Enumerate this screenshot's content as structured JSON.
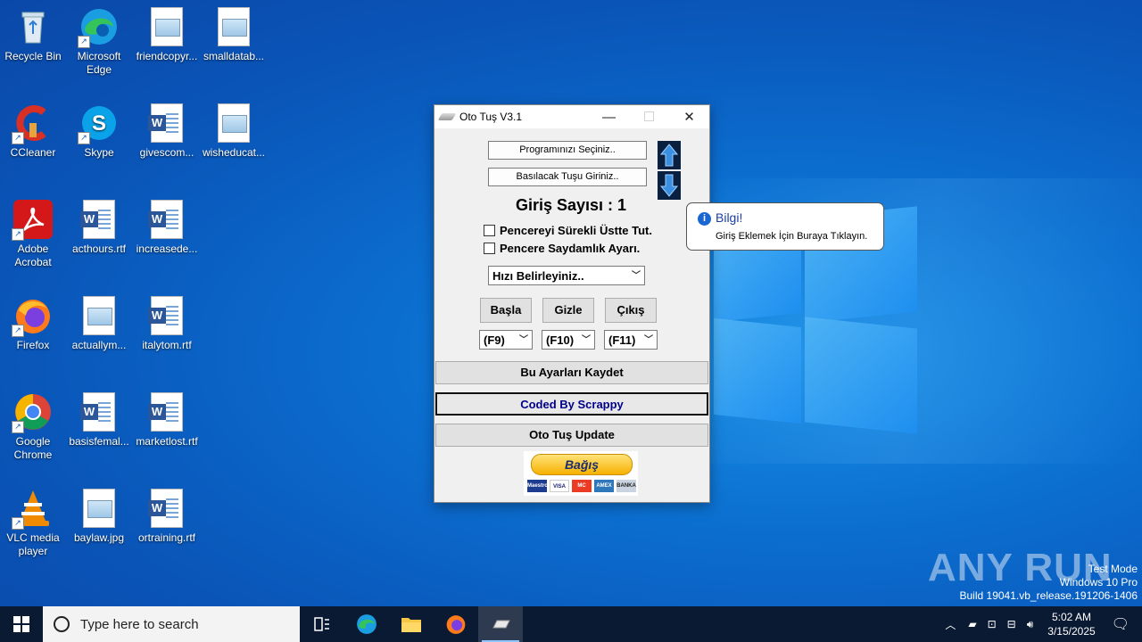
{
  "desktop": {
    "icons": [
      {
        "label": "Recycle Bin",
        "icon": "recycle-bin-icon"
      },
      {
        "label": "Microsoft Edge",
        "icon": "edge-icon"
      },
      {
        "label": "friendcopyr...",
        "icon": "image-file-icon"
      },
      {
        "label": "smalldatab...",
        "icon": "image-file-icon"
      },
      {
        "label": "CCleaner",
        "icon": "ccleaner-icon"
      },
      {
        "label": "Skype",
        "icon": "skype-icon"
      },
      {
        "label": "givescom...",
        "icon": "word-file-icon"
      },
      {
        "label": "wisheducat...",
        "icon": "image-file-icon"
      },
      {
        "label": "Adobe Acrobat",
        "icon": "acrobat-icon"
      },
      {
        "label": "acthours.rtf",
        "icon": "word-file-icon"
      },
      {
        "label": "increasede...",
        "icon": "word-file-icon"
      },
      {
        "label": "Firefox",
        "icon": "firefox-icon"
      },
      {
        "label": "actuallym...",
        "icon": "image-file-icon"
      },
      {
        "label": "italytom.rtf",
        "icon": "word-file-icon"
      },
      {
        "label": "Google Chrome",
        "icon": "chrome-icon"
      },
      {
        "label": "basisfemal...",
        "icon": "word-file-icon"
      },
      {
        "label": "marketlost.rtf",
        "icon": "word-file-icon"
      },
      {
        "label": "VLC media player",
        "icon": "vlc-icon"
      },
      {
        "label": "baylaw.jpg",
        "icon": "image-file-icon"
      },
      {
        "label": "ortraining.rtf",
        "icon": "word-file-icon"
      }
    ]
  },
  "window": {
    "title": "Oto Tuş V3.1",
    "btn_select_program": "Programınızı Seçiniz..",
    "btn_enter_key": "Basılacak Tuşu Giriniz..",
    "entry_count": "Giriş Sayısı : 1",
    "chk_always_on_top": "Pencereyi Sürekli Üstte Tut.",
    "chk_transparency": "Pencere Saydamlık Ayarı.",
    "speed_select": "Hızı Belirleyiniz..",
    "btn_start": "Başla",
    "btn_hide": "Gizle",
    "btn_exit": "Çıkış",
    "key_start": "(F9)",
    "key_hide": "(F10)",
    "key_exit": "(F11)",
    "btn_save": "Bu Ayarları Kaydet",
    "btn_credit": "Coded By Scrappy",
    "btn_update": "Oto Tuş Update",
    "donate_label": "Bağış",
    "cards": [
      "Maestro",
      "VISA",
      "MC",
      "AMEX",
      "BANKA"
    ]
  },
  "balloon": {
    "title": "Bilgi!",
    "text": "Giriş Eklemek İçin Buraya Tıklayın."
  },
  "watermark": {
    "brand": "ANY RUN",
    "line1": "Test Mode",
    "line2": "Windows 10 Pro",
    "line3": "Build 19041.vb_release.191206-1406"
  },
  "taskbar": {
    "search_placeholder": "Type here to search",
    "time": "5:02 AM",
    "date": "3/15/2025"
  },
  "colors": {
    "taskbar": "#0b1a33",
    "credit_text": "#00008b",
    "balloon_title": "#1a3fa0"
  }
}
